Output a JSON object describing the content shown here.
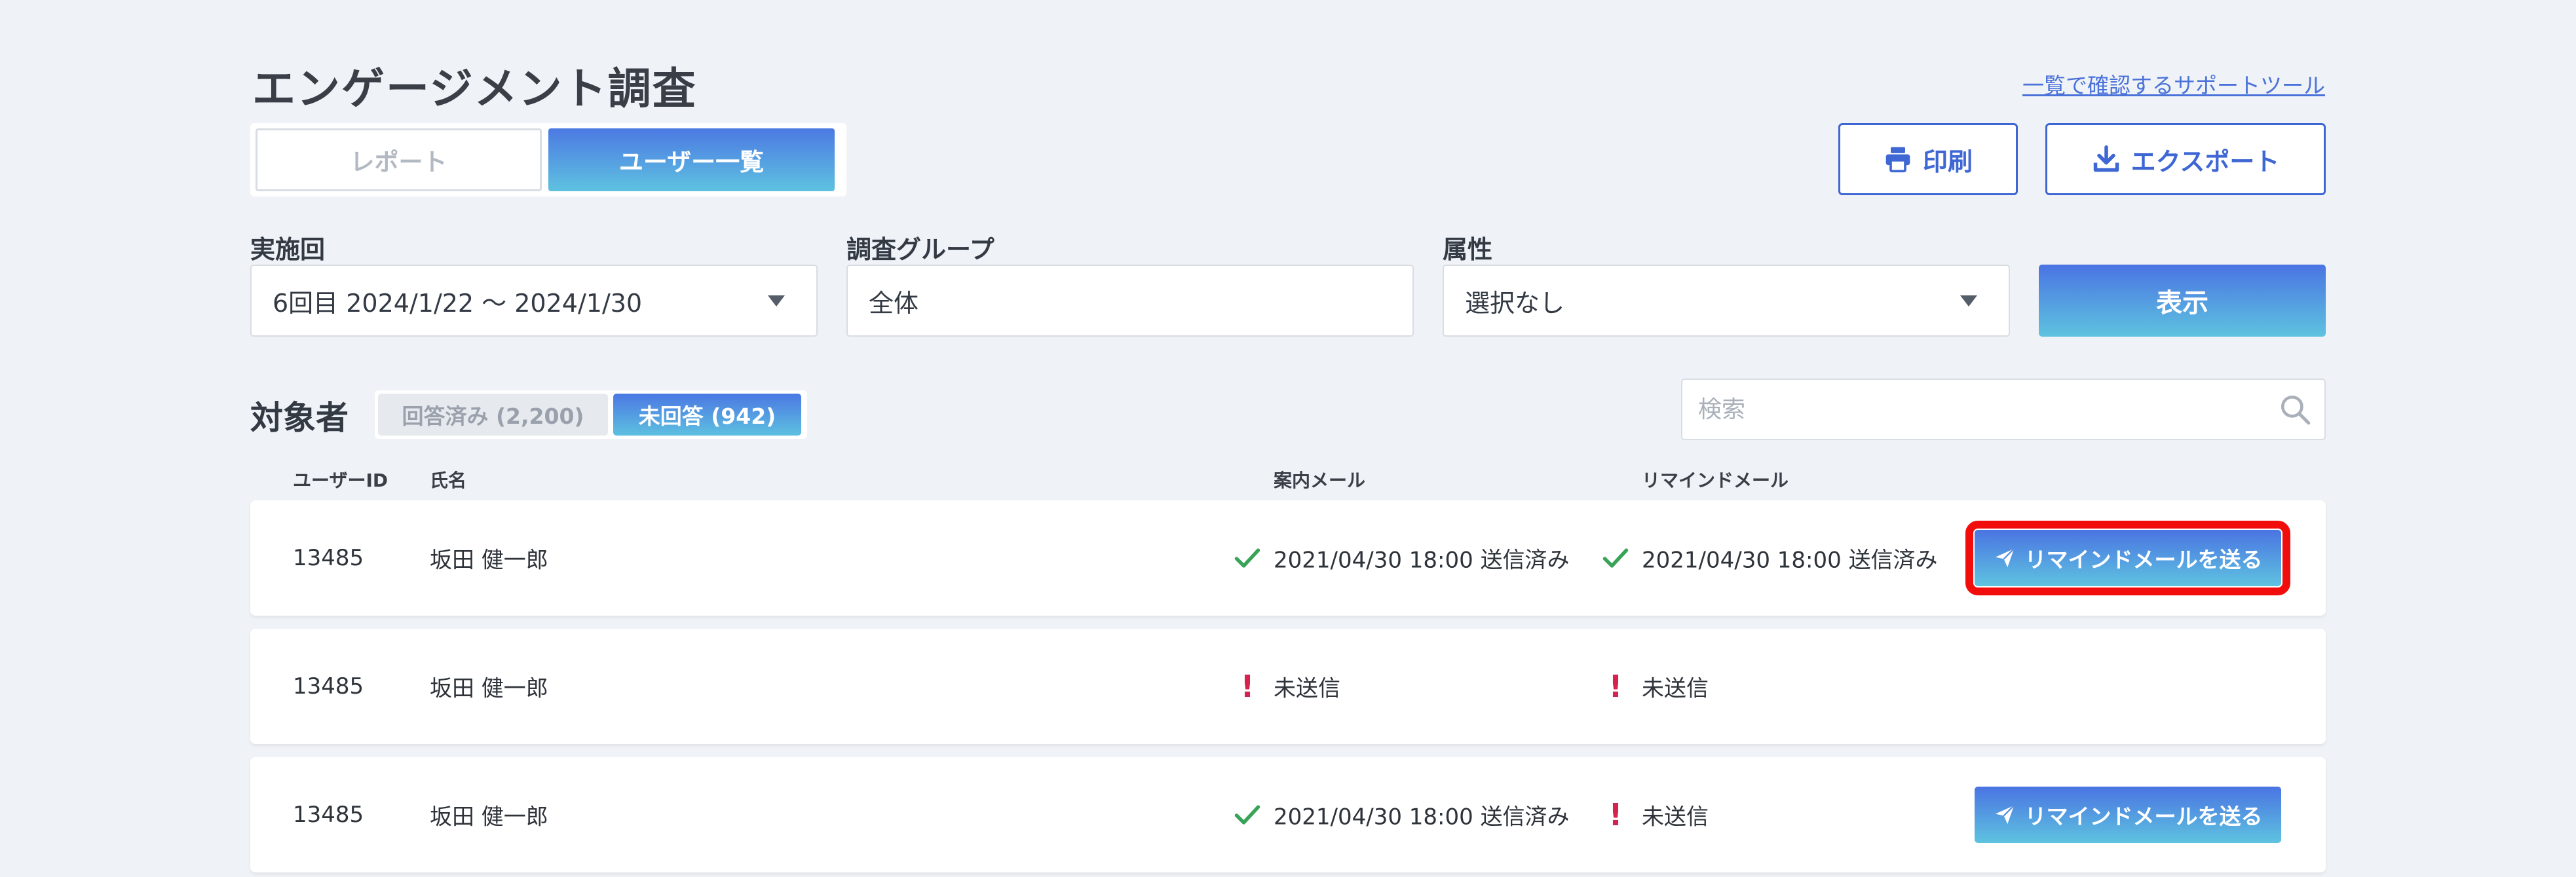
{
  "header": {
    "title": "エンゲージメント調査",
    "support_link": "一覧で確認するサポートツール"
  },
  "view_tabs": [
    {
      "label": "レポート",
      "active": false
    },
    {
      "label": "ユーザー一覧",
      "active": true
    }
  ],
  "actions": {
    "print_label": "印刷",
    "export_label": "エクスポート"
  },
  "filters": {
    "session": {
      "label": "実施回",
      "value": "6回目  2024/1/22 〜 2024/1/30"
    },
    "group": {
      "label": "調査グループ",
      "value": "全体"
    },
    "attribute": {
      "label": "属性",
      "value": "選択なし"
    },
    "display_label": "表示"
  },
  "targets": {
    "title": "対象者",
    "tabs": [
      {
        "label": "回答済み (2,200)",
        "active": false
      },
      {
        "label": "未回答 (942)",
        "active": true
      }
    ],
    "search_placeholder": "検索"
  },
  "table": {
    "columns": {
      "user_id": "ユーザーID",
      "name": "氏名",
      "guide_mail": "案内メール",
      "remind_mail": "リマインドメール"
    },
    "remind_button_label": "リマインドメールを送る",
    "rows": [
      {
        "user_id": "13485",
        "name": "坂田 健一郎",
        "guide_status": "sent",
        "guide_text": "2021/04/30 18:00 送信済み",
        "remind_status": "sent",
        "remind_text": "2021/04/30 18:00 送信済み",
        "has_button": true,
        "highlighted": true
      },
      {
        "user_id": "13485",
        "name": "坂田 健一郎",
        "guide_status": "unsent",
        "guide_text": "未送信",
        "remind_status": "unsent",
        "remind_text": "未送信",
        "has_button": false,
        "highlighted": false
      },
      {
        "user_id": "13485",
        "name": "坂田 健一郎",
        "guide_status": "sent",
        "guide_text": "2021/04/30 18:00 送信済み",
        "remind_status": "unsent",
        "remind_text": "未送信",
        "has_button": true,
        "highlighted": false
      }
    ]
  },
  "colors": {
    "accent": "#3f67d4",
    "sent_check": "#3aa35a",
    "unsent_mark": "#d5224e",
    "highlight": "#f20d0d",
    "background": "#eff2f6"
  },
  "icons": {
    "print": "printer-icon",
    "export": "download-icon",
    "search": "search-icon",
    "send": "paper-plane-icon",
    "sent": "check-icon",
    "unsent": "exclamation-icon"
  }
}
